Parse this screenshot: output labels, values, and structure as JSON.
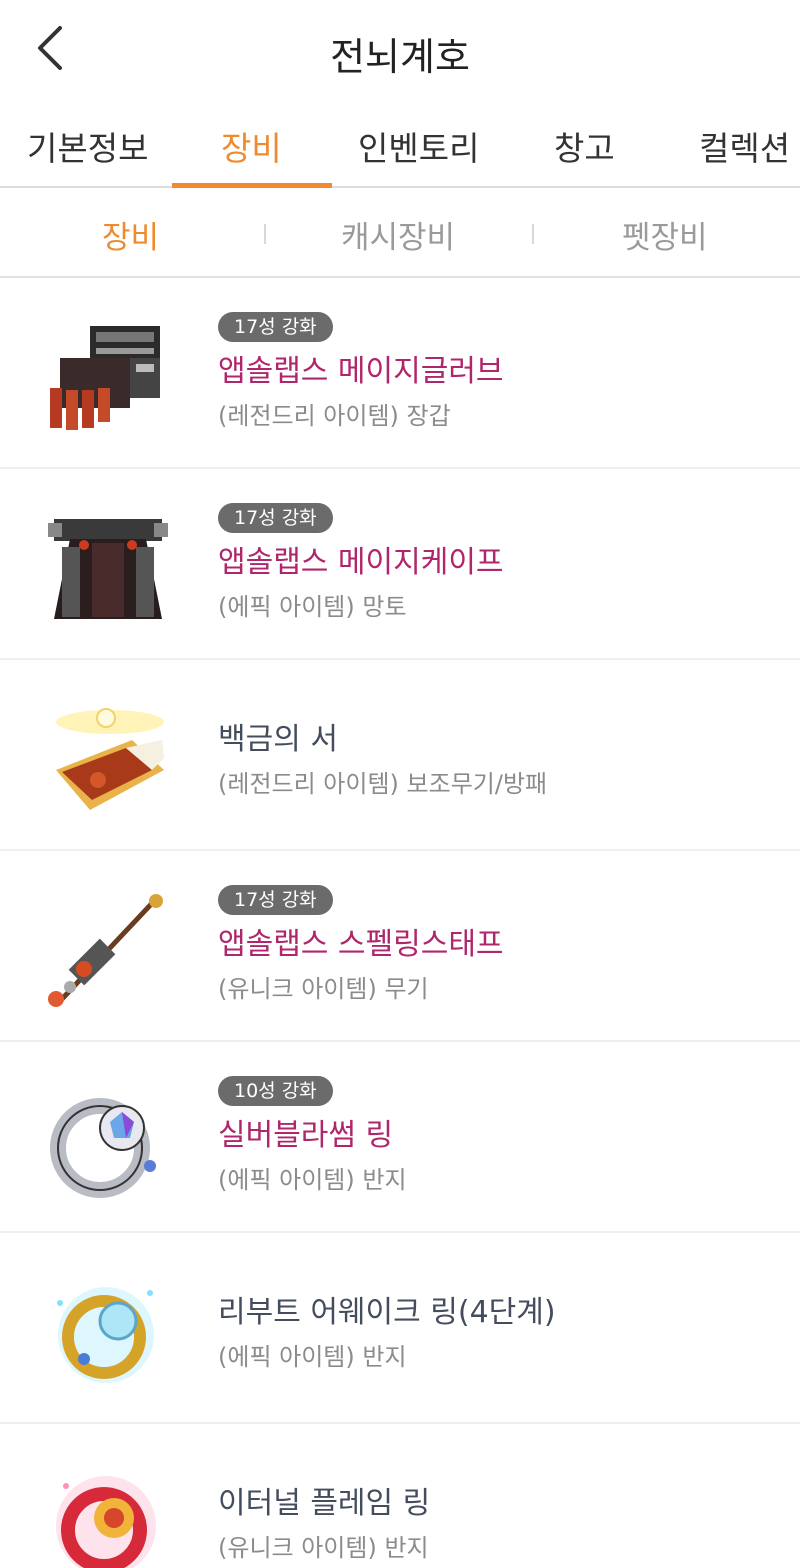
{
  "header": {
    "title": "전뇌계호",
    "back_icon": "chevron-left-icon"
  },
  "tabs": [
    {
      "label": "기본정보",
      "active": false
    },
    {
      "label": "장비",
      "active": true
    },
    {
      "label": "인벤토리",
      "active": false
    },
    {
      "label": "창고",
      "active": false
    },
    {
      "label": "컬렉션",
      "active": false
    }
  ],
  "subtabs": [
    {
      "label": "장비",
      "active": true
    },
    {
      "label": "캐시장비",
      "active": false
    },
    {
      "label": "펫장비",
      "active": false
    }
  ],
  "colors": {
    "accent": "#ef8a2e",
    "starred_name": "#b0266c",
    "plain_name": "#444d5d",
    "badge_bg": "#6b6b6b",
    "subtext": "#8b8b8b"
  },
  "items": [
    {
      "badge": "17성 강화",
      "name": "앱솔랩스 메이지글러브",
      "sub": "(레전드리 아이템) 장갑",
      "icon": "glove-icon"
    },
    {
      "badge": "17성 강화",
      "name": "앱솔랩스 메이지케이프",
      "sub": "(에픽 아이템) 망토",
      "icon": "cape-icon"
    },
    {
      "badge": "",
      "name": "백금의 서",
      "sub": "(레전드리 아이템) 보조무기/방패",
      "icon": "book-icon"
    },
    {
      "badge": "17성 강화",
      "name": "앱솔랩스 스펠링스태프",
      "sub": "(유니크 아이템) 무기",
      "icon": "staff-icon"
    },
    {
      "badge": "10성 강화",
      "name": "실버블라썸 링",
      "sub": "(에픽 아이템) 반지",
      "icon": "silver-ring-icon"
    },
    {
      "badge": "",
      "name": "리부트 어웨이크 링(4단계)",
      "sub": "(에픽 아이템) 반지",
      "icon": "awake-ring-icon"
    },
    {
      "badge": "",
      "name": "이터널 플레임 링",
      "sub": "(유니크 아이템) 반지",
      "icon": "flame-ring-icon"
    }
  ]
}
